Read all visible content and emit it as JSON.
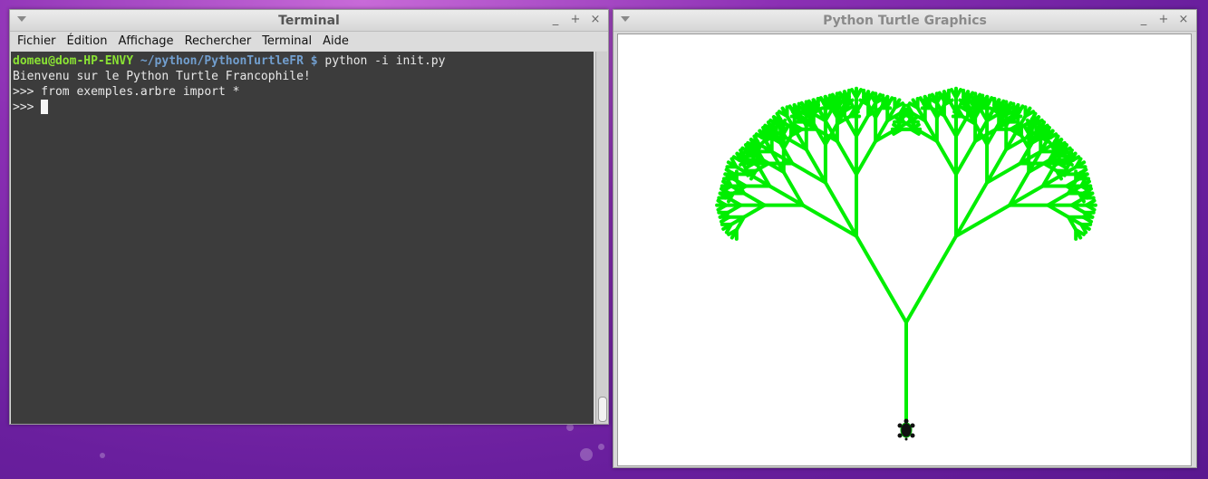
{
  "terminal": {
    "title": "Terminal",
    "window_buttons": [
      "_",
      "+",
      "×"
    ],
    "menu": [
      "Fichier",
      "Édition",
      "Affichage",
      "Rechercher",
      "Terminal",
      "Aide"
    ],
    "prompt_user": "domeu@dom-HP-ENVY",
    "prompt_path": "~/python/PythonTurtleFR",
    "prompt_symbol": "$",
    "command": "python -i init.py",
    "output": [
      "Bienvenu sur le Python Turtle Francophile!",
      ">>> from exemples.arbre import *",
      ">>> "
    ]
  },
  "turtle_window": {
    "title": "Python Turtle Graphics",
    "window_buttons": [
      "_",
      "+",
      "×"
    ],
    "tree_color": "#00ee00",
    "turtle_icon": "turtle-icon"
  }
}
